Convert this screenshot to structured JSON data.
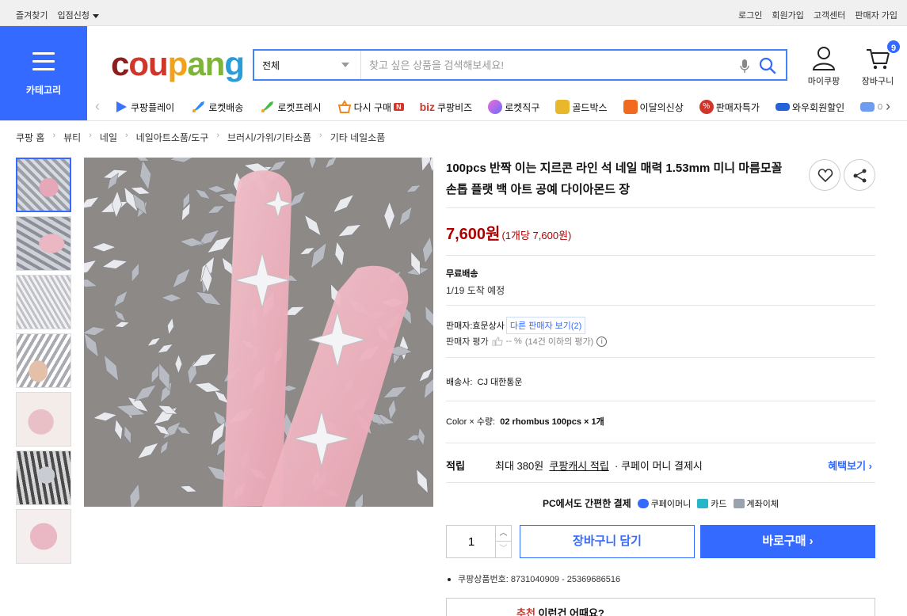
{
  "topbar": {
    "favorites": "즐겨찾기",
    "apply": "입점신청",
    "login": "로그인",
    "signup": "회원가입",
    "cs": "고객센터",
    "seller_signup": "판매자 가입"
  },
  "header": {
    "category_label": "카테고리",
    "logo": [
      "c",
      "ou",
      "p",
      "an",
      "g"
    ],
    "search_select": "전체",
    "search_placeholder": "찾고 싶은 상품을 검색해보세요!",
    "mycoupang": "마이쿠팡",
    "cart": "장바구니",
    "cart_count": "9"
  },
  "nav": {
    "items": [
      {
        "label": "쿠팡플레이",
        "color": "#3b73ff"
      },
      {
        "label": "로켓배송",
        "color": "#2f8cff"
      },
      {
        "label": "로켓프레시",
        "color": "#49b94a"
      },
      {
        "label": "다시 구매",
        "color": "#f08a1e"
      },
      {
        "label": "쿠팡비즈",
        "color": "#d1362b"
      },
      {
        "label": "로켓직구",
        "color": "#9b5ce6"
      },
      {
        "label": "골드박스",
        "color": "#e8b72a"
      },
      {
        "label": "이달의신상",
        "color": "#f26a21"
      },
      {
        "label": "판매자특가",
        "color": "#d1362b"
      },
      {
        "label": "와우회원할인",
        "color": "#2464d8"
      },
      {
        "label": "이",
        "color": "#6e9cf0"
      }
    ],
    "rebuy_badge": "N",
    "biz_prefix": "biz"
  },
  "breadcrumb": [
    "쿠팡 홈",
    "뷰티",
    "네일",
    "네일아트소품/도구",
    "브러시/가위/기타소품",
    "기타 네일소품"
  ],
  "product": {
    "title": "100pcs 반짝 이는 지르콘 라인 석 네일 매력 1.53mm 미니 마름모꼴 손톱 플랫 백 아트 공예 다이아몬드 장",
    "price": "7,600원",
    "unit_price": "(1개당 7,600원)",
    "free_shipping": "무료배송",
    "arrival": "1/19 도착 예정",
    "seller_label": "판매자:",
    "seller_name": "효문상사",
    "other_sellers": "다른 판매자 보기(2)",
    "seller_rating_label": "판매자 평가",
    "seller_rating_value": "-- %",
    "seller_rating_note": "(14건 이하의 평가)",
    "shipper_label": "배송사:",
    "shipper": "CJ 대한통운",
    "option_label": "Color × 수량:",
    "option_value": "02 rhombus 100pcs × 1개",
    "reward_label": "적립",
    "reward_max": "최대 380원",
    "reward_link": "쿠팡캐시 적립",
    "reward_note": "· 쿠페이 머니 결제시",
    "reward_more": "혜택보기",
    "pay_title": "PC에서도 간편한 결제",
    "pay_methods": [
      {
        "label": "쿠페이머니",
        "color": "#346aff"
      },
      {
        "label": "카드",
        "color": "#27b5c8"
      },
      {
        "label": "계좌이체",
        "color": "#9aa3ad"
      }
    ],
    "quantity": "1",
    "cart_button": "장바구니 담기",
    "buy_button": "바로구매",
    "product_no": "쿠팡상품번호: 8731040909 - 25369686516",
    "reco_prefix": "추천",
    "reco_text": "이런건 어때요?"
  }
}
